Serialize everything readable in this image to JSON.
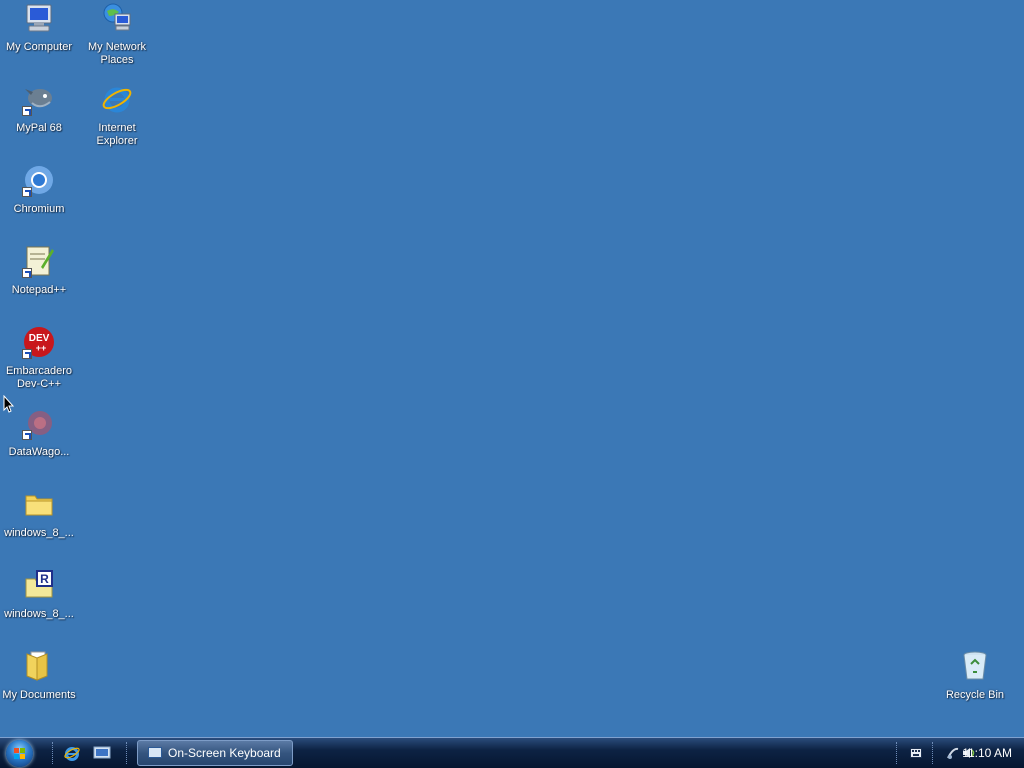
{
  "desktop": {
    "icons": [
      {
        "label": "My Computer"
      },
      {
        "label": "My Network Places"
      },
      {
        "label": "MyPal 68"
      },
      {
        "label": "Internet Explorer"
      },
      {
        "label": "Chromium"
      },
      {
        "label": "Notepad++"
      },
      {
        "label": "Embarcadero Dev-C++"
      },
      {
        "label": "DataWago..."
      },
      {
        "label": "windows_8_..."
      },
      {
        "label": "windows_8_..."
      },
      {
        "label": "My Documents"
      },
      {
        "label": "Recycle Bin"
      }
    ],
    "background_color": "#3b78b6"
  },
  "taskbar": {
    "start_icon": "windows-flag-icon",
    "quick_launch": [
      "internet-explorer-icon",
      "show-desktop-icon"
    ],
    "window_button": {
      "label": "On-Screen Keyboard",
      "icon": "keyboard-icon"
    },
    "tray": {
      "clock": "11:10 AM",
      "icons": [
        "keyboard-tray-icon",
        "network-icon",
        "volume-icon"
      ]
    }
  }
}
